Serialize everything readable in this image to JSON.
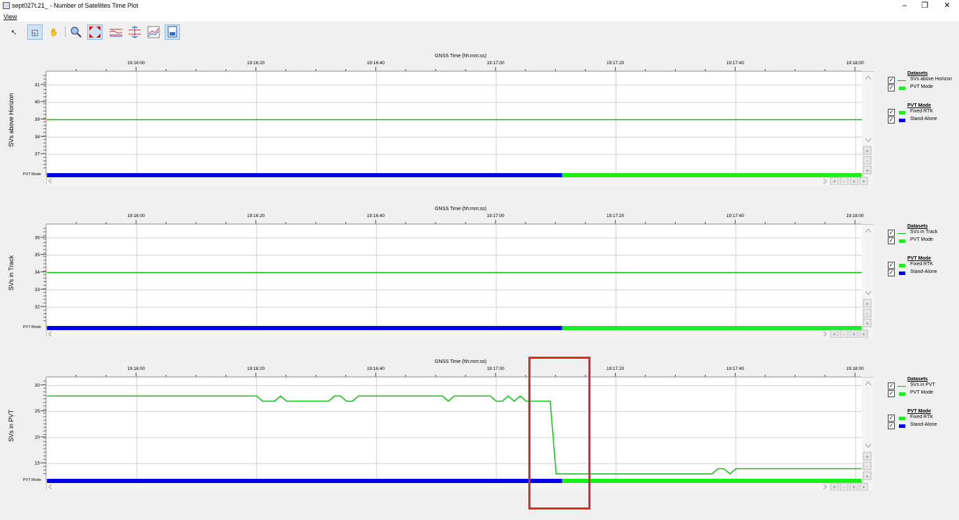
{
  "window": {
    "title": "sept027t.21_ - Number of Satellites Time Plot",
    "minimize": "–",
    "restore": "❐",
    "close": "✕"
  },
  "menu": {
    "view": "View"
  },
  "toolbar": {
    "icons": [
      "pointer-icon",
      "zoom-box-icon",
      "pan-hand-icon",
      "magnify-icon",
      "zoom-extent-icon",
      "multi-series-icon",
      "vertical-range-icon",
      "stacked-chart-icon",
      "export-icon"
    ]
  },
  "colors": {
    "sv_line": "#00c000",
    "fixed_rtk": "#1aef1a",
    "stand_alone": "#0000e6",
    "highlight": "#e0262b"
  },
  "time_axis": {
    "title": "GNSS Time (hh:mm:ss)",
    "ticks": [
      "19:16:00",
      "19:16:20",
      "19:16:40",
      "19:17:00",
      "19:17:20",
      "19:17:40",
      "19:18:00"
    ]
  },
  "pvt_mode_label": "PVT Mode",
  "panels": [
    {
      "ylabel": "SVs above Horizon",
      "yticks": [
        "41",
        "40",
        "39",
        "38",
        "37"
      ],
      "legend": {
        "datasets_title": "Datasets",
        "datasets": [
          "SVs above Horizon",
          "PVT Mode"
        ],
        "pvt_title": "PVT Mode",
        "modes": [
          "Fixed RTK",
          "Stand-Alone"
        ]
      }
    },
    {
      "ylabel": "SVs in Track",
      "yticks": [
        "36",
        "35",
        "34",
        "33",
        "32"
      ],
      "legend": {
        "datasets_title": "Datasets",
        "datasets": [
          "SVs in Track",
          "PVT Mode"
        ],
        "pvt_title": "PVT Mode",
        "modes": [
          "Fixed RTK",
          "Stand-Alone"
        ]
      }
    },
    {
      "ylabel": "SVs in PVT",
      "yticks": [
        "30",
        "25",
        "20",
        "15"
      ],
      "legend": {
        "datasets_title": "Datasets",
        "datasets": [
          "SVs in PVT",
          "PVT Mode"
        ],
        "pvt_title": "PVT Mode",
        "modes": [
          "Fixed RTK",
          "Stand-Alone"
        ]
      }
    }
  ],
  "chart_data": [
    {
      "type": "line",
      "xlabel": "GNSS Time (hh:mm:ss)",
      "ylabel": "SVs above Horizon",
      "ylim": [
        36.2,
        41.6
      ],
      "x_range": [
        "19:15:45",
        "19:18:01"
      ],
      "series": [
        {
          "name": "SVs above Horizon",
          "x": [
            "19:15:45",
            "19:18:01"
          ],
          "values": [
            39,
            39
          ]
        }
      ],
      "pvt_mode": [
        {
          "mode": "Stand-Alone",
          "from": "19:15:45",
          "to": "19:17:11"
        },
        {
          "mode": "Fixed RTK",
          "from": "19:17:11",
          "to": "19:18:01"
        }
      ]
    },
    {
      "type": "line",
      "xlabel": "GNSS Time (hh:mm:ss)",
      "ylabel": "SVs in Track",
      "ylim": [
        31.2,
        36.6
      ],
      "x_range": [
        "19:15:45",
        "19:18:01"
      ],
      "series": [
        {
          "name": "SVs in Track",
          "x": [
            "19:15:45",
            "19:18:01"
          ],
          "values": [
            34,
            34
          ]
        }
      ],
      "pvt_mode": [
        {
          "mode": "Stand-Alone",
          "from": "19:15:45",
          "to": "19:17:11"
        },
        {
          "mode": "Fixed RTK",
          "from": "19:17:11",
          "to": "19:18:01"
        }
      ]
    },
    {
      "type": "line",
      "xlabel": "GNSS Time (hh:mm:ss)",
      "ylabel": "SVs in PVT",
      "ylim": [
        13,
        31
      ],
      "x_range": [
        "19:15:45",
        "19:18:01"
      ],
      "series": [
        {
          "name": "SVs in PVT",
          "x": [
            "19:15:45",
            "19:16:20",
            "19:16:21",
            "19:16:23",
            "19:16:24",
            "19:16:25",
            "19:16:32",
            "19:16:33",
            "19:16:34",
            "19:16:35",
            "19:16:36",
            "19:16:37",
            "19:16:51",
            "19:16:52",
            "19:16:53",
            "19:16:59",
            "19:17:00",
            "19:17:01",
            "19:17:02",
            "19:17:03",
            "19:17:04",
            "19:17:05",
            "19:17:06",
            "19:17:07",
            "19:17:09",
            "19:17:10",
            "19:17:18",
            "19:17:36",
            "19:17:37",
            "19:17:38",
            "19:17:39",
            "19:17:40",
            "19:18:01"
          ],
          "values": [
            28,
            28,
            27,
            27,
            28,
            27,
            27,
            28,
            28,
            27,
            27,
            28,
            28,
            27,
            28,
            28,
            27,
            27,
            28,
            27,
            28,
            27,
            27,
            27,
            27,
            13,
            13,
            13,
            14,
            14,
            13,
            14,
            14
          ]
        }
      ],
      "pvt_mode": [
        {
          "mode": "Stand-Alone",
          "from": "19:15:45",
          "to": "19:17:11"
        },
        {
          "mode": "Fixed RTK",
          "from": "19:17:11",
          "to": "19:18:01"
        }
      ]
    }
  ]
}
